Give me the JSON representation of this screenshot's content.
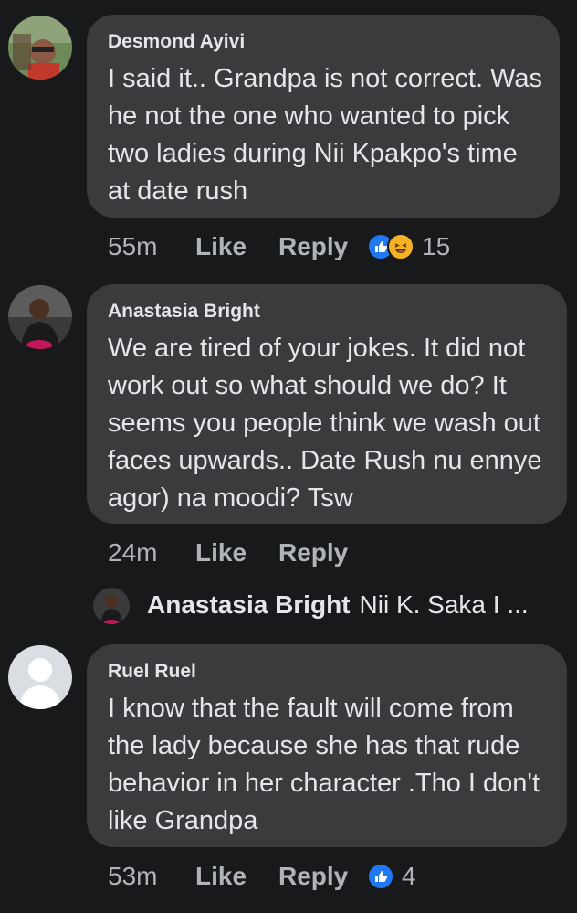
{
  "comments": [
    {
      "author": "Desmond Ayivi",
      "text": "I said it.. Grandpa is not correct. Was he not the one who wanted to pick two ladies during Nii Kpakpo's time at date rush",
      "time": "55m",
      "like_label": "Like",
      "reply_label": "Reply",
      "reactions": [
        "like-icon",
        "haha-icon"
      ],
      "reaction_count": "15"
    },
    {
      "author": "Anastasia Bright",
      "text": "We are tired of your jokes. It did not work out so what should we do? It seems you people think we wash out faces upwards.. Date Rush nu ennye agor) na moodi? Tsw",
      "time": "24m",
      "like_label": "Like",
      "reply_label": "Reply",
      "reply_preview": {
        "author": "Anastasia Bright",
        "text": "Nii K. Saka I ..."
      }
    },
    {
      "author": "Ruel Ruel",
      "text": "I know that the fault will come from the lady because she has that rude behavior in her character .Tho I don't like Grandpa",
      "time": "53m",
      "like_label": "Like",
      "reply_label": "Reply",
      "reactions": [
        "like-icon"
      ],
      "reaction_count": "4"
    }
  ],
  "colors": {
    "background": "#18191a",
    "bubble": "#3a3b3c",
    "text": "#e4e6eb",
    "meta": "#b0b3b8",
    "like_blue": "#2078f4",
    "haha_yellow": "#f7b125"
  }
}
